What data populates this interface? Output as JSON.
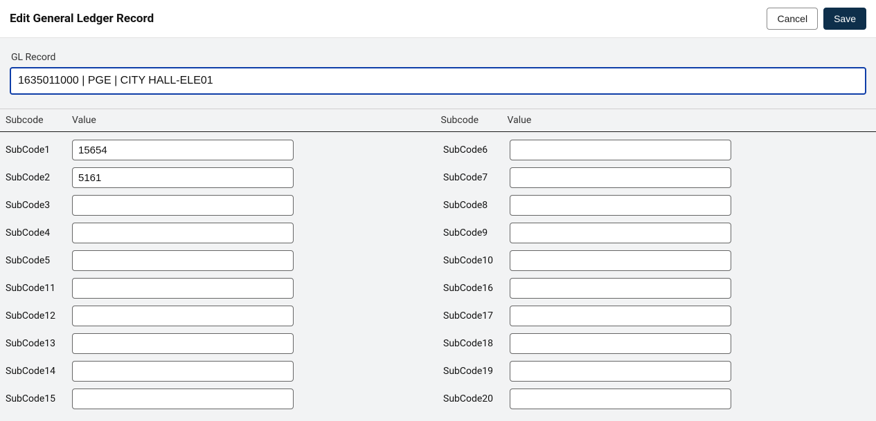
{
  "header": {
    "title": "Edit General Ledger Record",
    "cancel_label": "Cancel",
    "save_label": "Save"
  },
  "gl_record": {
    "label": "GL Record",
    "value": "1635011000 | PGE | CITY HALL-ELE01"
  },
  "table": {
    "headers": {
      "subcode": "Subcode",
      "value": "Value"
    }
  },
  "rows": [
    {
      "left_label": "SubCode1",
      "left_value": "15654",
      "right_label": "SubCode6",
      "right_value": ""
    },
    {
      "left_label": "SubCode2",
      "left_value": "5161",
      "right_label": "SubCode7",
      "right_value": ""
    },
    {
      "left_label": "SubCode3",
      "left_value": "",
      "right_label": "SubCode8",
      "right_value": ""
    },
    {
      "left_label": "SubCode4",
      "left_value": "",
      "right_label": "SubCode9",
      "right_value": ""
    },
    {
      "left_label": "SubCode5",
      "left_value": "",
      "right_label": "SubCode10",
      "right_value": ""
    },
    {
      "left_label": "SubCode11",
      "left_value": "",
      "right_label": "SubCode16",
      "right_value": ""
    },
    {
      "left_label": "SubCode12",
      "left_value": "",
      "right_label": "SubCode17",
      "right_value": ""
    },
    {
      "left_label": "SubCode13",
      "left_value": "",
      "right_label": "SubCode18",
      "right_value": ""
    },
    {
      "left_label": "SubCode14",
      "left_value": "",
      "right_label": "SubCode19",
      "right_value": ""
    },
    {
      "left_label": "SubCode15",
      "left_value": "",
      "right_label": "SubCode20",
      "right_value": ""
    }
  ]
}
